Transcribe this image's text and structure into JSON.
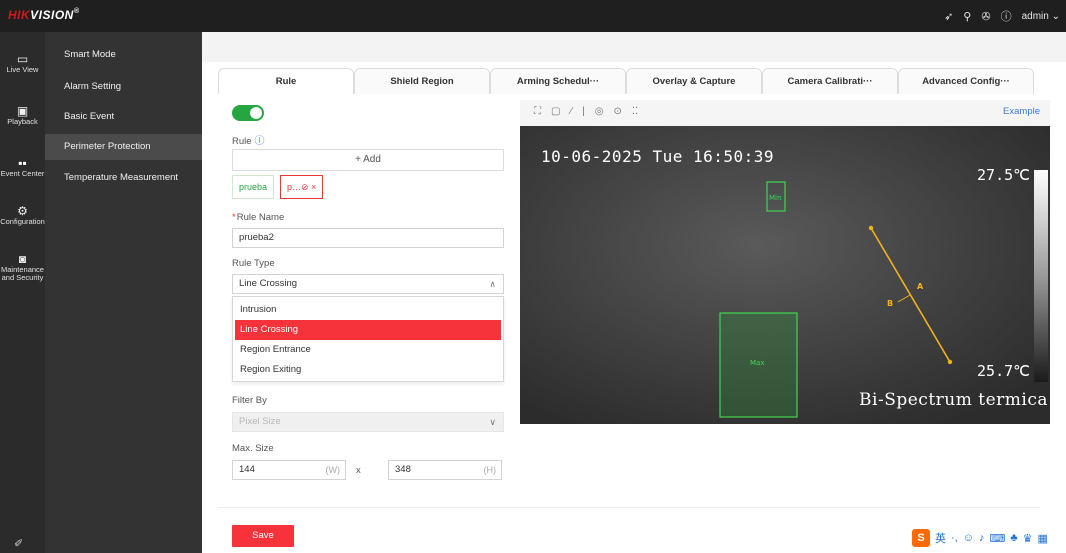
{
  "app": {
    "brand_red": "HIK",
    "brand_rest": "VISION",
    "brand_mark": "®",
    "user": "admin",
    "accent": "#f6323b",
    "toggle_on_color": "#26a641"
  },
  "top_icons": {
    "send": "➶",
    "search": "⚲",
    "hands": "✇",
    "info": "ⓘ",
    "chevron": "⌄"
  },
  "rail": [
    {
      "label": "Live View",
      "icon": "▭"
    },
    {
      "label": "Playback",
      "icon": "▣"
    },
    {
      "label": "Event Center",
      "icon": "▪▪"
    },
    {
      "label": "Configuration",
      "icon": "⚙"
    },
    {
      "label": "Maintenance and Security",
      "icon": "◙"
    }
  ],
  "rail_bottom_icon": "✐",
  "submenu": [
    {
      "label": "Smart Mode"
    },
    {
      "label": "Alarm Setting"
    },
    {
      "label": "Basic Event"
    },
    {
      "label": "Perimeter Protection"
    },
    {
      "label": "Temperature Measurement"
    }
  ],
  "tabs": [
    {
      "label": "Rule"
    },
    {
      "label": "Shield Region"
    },
    {
      "label": "Arming Schedul···"
    },
    {
      "label": "Overlay & Capture"
    },
    {
      "label": "Camera Calibrati···"
    },
    {
      "label": "Advanced Config···"
    }
  ],
  "form": {
    "rule_label": "Rule",
    "add_label": "+ Add",
    "chips": [
      {
        "label": "prueba"
      },
      {
        "label": "p…⊘ ×"
      }
    ],
    "rule_name_required": "*",
    "rule_name_label": "Rule Name",
    "rule_name_value": "prueba2",
    "rule_type_label": "Rule Type",
    "rule_type_value": "Line Crossing",
    "rule_type_options": [
      "Intrusion",
      "Line Crossing",
      "Region Entrance",
      "Region Exiting"
    ],
    "filter_by_label": "Filter By",
    "filter_by_value": "Pixel Size",
    "max_size_label": "Max. Size",
    "width_value": "144",
    "width_unit": "(W)",
    "size_separator": "x",
    "height_value": "348",
    "height_unit": "(H)",
    "save_label": "Save"
  },
  "video": {
    "example_link": "Example",
    "toolbar_icons": [
      "⛶",
      "▢",
      "⁄",
      "|",
      "◎",
      "⊙",
      "⁚⁚"
    ],
    "osd_time": "10-06-2025 Tue 16:50:39",
    "temp_high": "27.5℃",
    "temp_low": "25.7℃",
    "osd_bottom": "Bi-Spectrum termica",
    "min_label": "Min",
    "max_label": "Max",
    "line_label_a": "A",
    "line_label_b": "B"
  },
  "ime": {
    "logo": "S",
    "lang": "英",
    "symbols": [
      "·,",
      "☺",
      "♪",
      "⌨",
      "♣",
      "♛",
      "▦"
    ]
  }
}
